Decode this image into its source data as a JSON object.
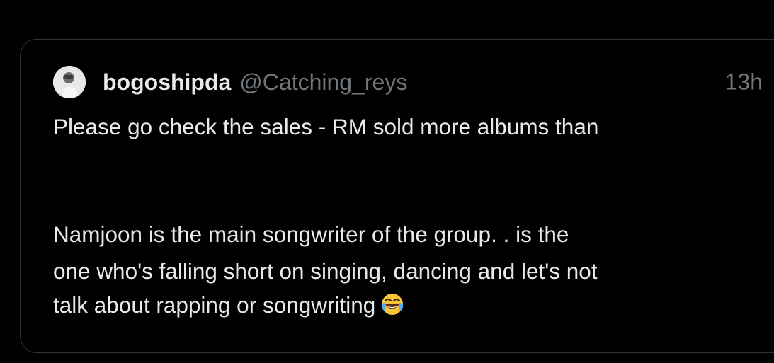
{
  "tweet": {
    "display_name": "bogoshipda",
    "handle": "@Catching_reys",
    "timestamp": "13h",
    "text_line_1": "Please go check the sales - RM sold more albums than",
    "text_line_2": "Namjoon is the main songwriter of the group. .      is the",
    "text_line_3": "one who's falling short on singing, dancing and let's not",
    "text_line_4": "talk about rapping or songwriting",
    "emoji": "face-with-tears-of-joy-icon"
  },
  "colors": {
    "background": "#000000",
    "text_primary": "#e7e9ea",
    "text_secondary": "#71767b",
    "border": "#2f3336"
  }
}
